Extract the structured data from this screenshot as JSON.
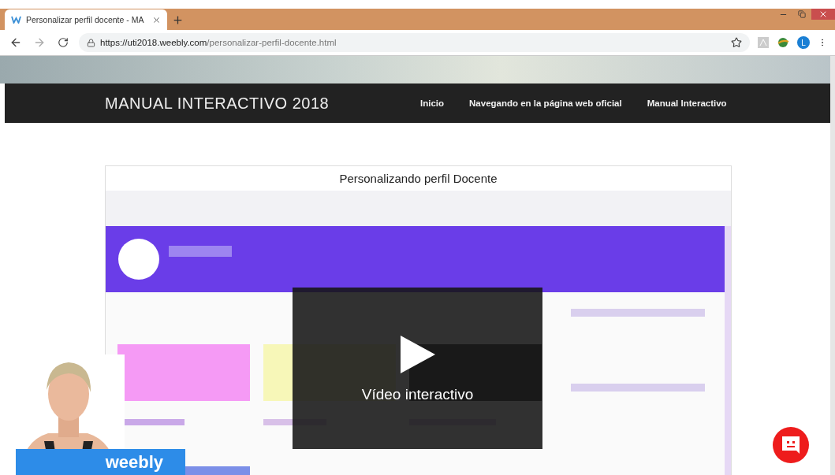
{
  "browser": {
    "tab": {
      "title": "Personalizar perfil docente - MA",
      "selected": true
    },
    "url_host": "https://uti2018.weebly.com",
    "url_path": "/personalizar-perfil-docente.html",
    "profile_initial": "L"
  },
  "site": {
    "title": "MANUAL INTERACTIVO 2018",
    "nav": [
      {
        "label": "Inicio"
      },
      {
        "label": "Navegando en la página web oficial"
      },
      {
        "label": "Manual Interactivo"
      }
    ]
  },
  "embed": {
    "title": "Personalizando perfil Docente",
    "video": {
      "kind": "picture",
      "overlay_label": "Vídeo interactivo"
    }
  },
  "badge": {
    "label": "weebly"
  }
}
